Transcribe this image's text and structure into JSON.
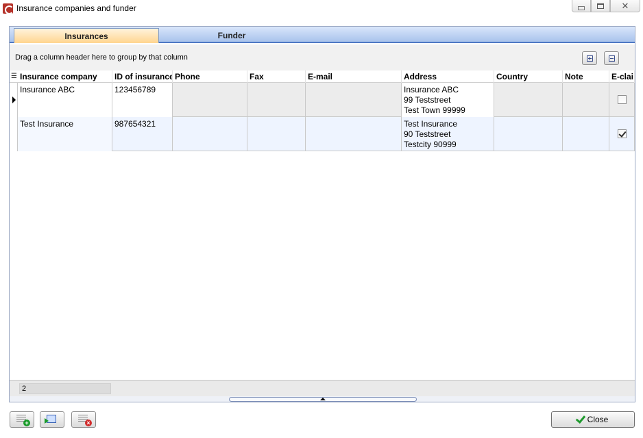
{
  "window": {
    "title": "Insurance companies and funder",
    "close_glyph": "✕"
  },
  "tabs": [
    {
      "label": "Insurances",
      "active": true
    },
    {
      "label": "Funder",
      "active": false
    }
  ],
  "group_panel": {
    "hint": "Drag a column header here to group by that column"
  },
  "grid": {
    "columns": [
      "Insurance company",
      "ID of insurance",
      "Phone",
      "Fax",
      "E-mail",
      "Address",
      "Country",
      "Note",
      "E-clai"
    ],
    "rows": [
      {
        "company": "Insurance ABC",
        "id": "123456789",
        "phone": "",
        "fax": "",
        "email": "",
        "address": [
          "Insurance ABC",
          "99 Teststreet",
          "Test Town 99999"
        ],
        "country": "",
        "note": "",
        "eclaim": false
      },
      {
        "company": "Test Insurance",
        "id": "987654321",
        "phone": "",
        "fax": "",
        "email": "",
        "address": [
          "Test Insurance",
          "90 Teststreet",
          "Testcity 90999"
        ],
        "country": "",
        "note": "",
        "eclaim": true
      }
    ],
    "record_count": "2"
  },
  "buttons": {
    "close_label": "Close"
  },
  "colors": {
    "active_tab": "#ffd58f",
    "tab_bar": "#a9c3ec",
    "selected_row": "#eef4ff"
  }
}
